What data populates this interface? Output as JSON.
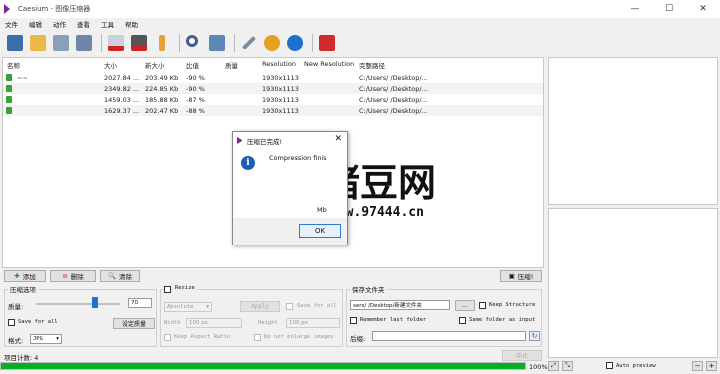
{
  "window": {
    "title": "Caesium - 图像压缩器",
    "minimize": "—",
    "maximize": "☐",
    "close": "✕"
  },
  "menu": [
    "文件",
    "编辑",
    "动作",
    "查看",
    "工具",
    "帮助"
  ],
  "toolbar": {
    "icons": [
      "add-files-icon",
      "add-folder-icon",
      "save-icon",
      "export-icon",
      "remove-icon",
      "clear-list-icon",
      "clean-icon",
      "zoom-icon",
      "preview-icon",
      "tools-icon",
      "settings-icon",
      "info-icon",
      "exit-icon"
    ]
  },
  "table": {
    "headers": [
      "名称",
      "大小",
      "新大小",
      "比值",
      "质量",
      "Resolution",
      "New Resolution",
      "完整路径"
    ],
    "rows": [
      {
        "name": "~~",
        "size": "2027.84 ...",
        "new_size": "203.49 Kb",
        "ratio": "-90 %",
        "quality": "",
        "resolution": "1930x1113",
        "new_resolution": "",
        "path": "C:/Users/        /Desktop/..."
      },
      {
        "name": "",
        "size": "2349.82 ...",
        "new_size": "224.85 Kb",
        "ratio": "-90 %",
        "quality": "",
        "resolution": "1930x1113",
        "new_resolution": "",
        "path": "C:/Users/        /Desktop/..."
      },
      {
        "name": "",
        "size": "1459.03 ...",
        "new_size": "185.88 Kb",
        "ratio": "-87 %",
        "quality": "",
        "resolution": "1930x1113",
        "new_resolution": "",
        "path": "C:/Users/        /Desktop/..."
      },
      {
        "name": "",
        "size": "1629.37 ...",
        "new_size": "202.47 Kb",
        "ratio": "-88 %",
        "quality": "",
        "resolution": "1930x1113",
        "new_resolution": "",
        "path": "C:/Users/        /Desktop/..."
      }
    ]
  },
  "dialog": {
    "title": "压缩已完成!",
    "message": "Compression finis",
    "message2": "Mb",
    "ok": "OK"
  },
  "watermark": {
    "text": "猪豆网",
    "url": "www.97444.cn"
  },
  "buttons": {
    "add": "添加",
    "remove": "删除",
    "clear": "清除",
    "compress": "压缩!"
  },
  "compression": {
    "group": "压缩选项",
    "quality_label": "质量:",
    "quality_value": "70",
    "quality_level": 0.7,
    "save_for_all": "Save for all",
    "set_quality": "设定质量",
    "format_label": "格式:",
    "format_value": "JPG"
  },
  "resize": {
    "group": "Resize",
    "mode": "Absolute",
    "apply": "Apply",
    "save_for_all": "Save for all",
    "width_label": "Width",
    "width_value": "100 px",
    "height_label": "Height",
    "height_value": "100 px",
    "keep_aspect": "Keep Aspect Ratio",
    "no_enlarge": "Do not enlarge images"
  },
  "output": {
    "group": "保存文件夹",
    "path": "sers/        /Desktop/新建文件夹",
    "browse": "...",
    "keep_structure": "Keep Structure",
    "remember": "Remember last folder",
    "same_folder": "Same folder as input",
    "suffix_label": "后缀:",
    "suffix_value": ""
  },
  "status": {
    "count": "项目计数: 4",
    "cancel": "中止",
    "percent": "100%",
    "auto_preview": "Auto preview",
    "progress": 1.0
  },
  "colors": {
    "progress": "#06b025",
    "accent": "#1d5fb6"
  }
}
